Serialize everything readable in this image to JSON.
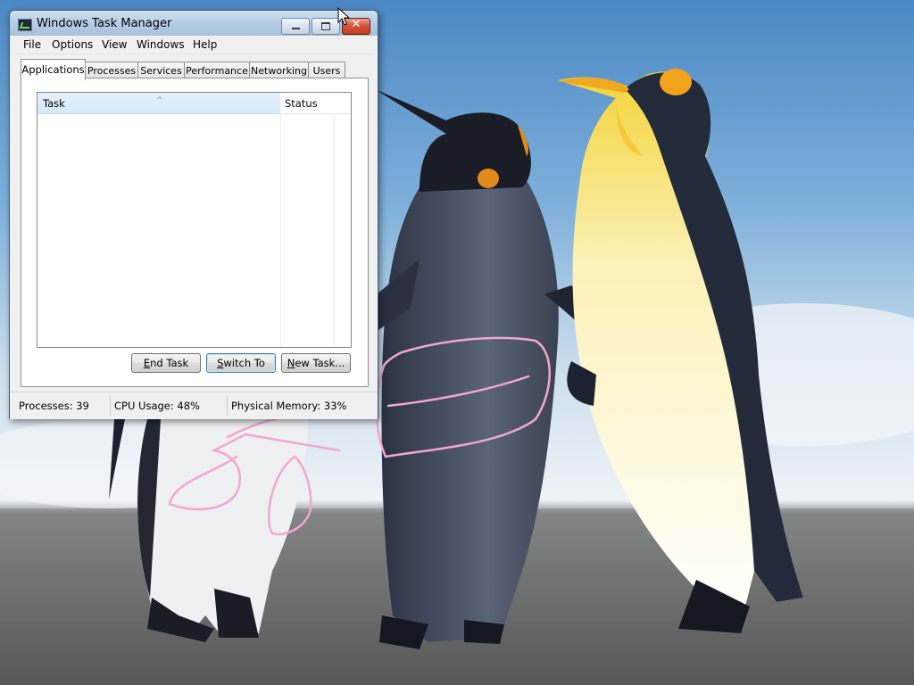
{
  "desktop": {
    "wallpaper": "penguins-wallpaper"
  },
  "window": {
    "title": "Windows Task Manager",
    "icon": "task-manager-icon",
    "controls": {
      "minimize": "minimize-icon",
      "maximize": "maximize-icon",
      "close": "close-icon"
    }
  },
  "menu": {
    "items": [
      {
        "label": "File"
      },
      {
        "label": "Options"
      },
      {
        "label": "View"
      },
      {
        "label": "Windows"
      },
      {
        "label": "Help"
      }
    ]
  },
  "tabs": [
    {
      "label": "Applications",
      "active": true
    },
    {
      "label": "Processes",
      "active": false
    },
    {
      "label": "Services",
      "active": false
    },
    {
      "label": "Performance",
      "active": false
    },
    {
      "label": "Networking",
      "active": false
    },
    {
      "label": "Users",
      "active": false
    }
  ],
  "list": {
    "columns": [
      {
        "label": "Task"
      },
      {
        "label": "Status"
      }
    ],
    "sort_icon": "sort-ascending-icon",
    "rows": []
  },
  "buttons": {
    "end_task": {
      "mnemonic": "E",
      "rest": "nd Task"
    },
    "switch_to": {
      "mnemonic": "S",
      "rest": "witch To"
    },
    "new_task": {
      "mnemonic": "N",
      "rest": "ew Task..."
    }
  },
  "status": {
    "processes": "Processes: 39",
    "cpu": "CPU Usage: 48%",
    "memory": "Physical Memory: 33%"
  },
  "colors": {
    "close_button": "#c13a21",
    "annotation_stroke": "#f3a6d2"
  }
}
